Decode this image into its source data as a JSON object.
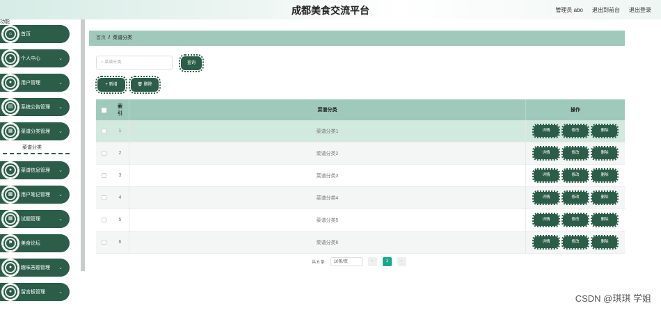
{
  "header": {
    "title": "成都美食交流平台",
    "admin_label": "管理员 abo",
    "to_front": "退出到前台",
    "logout": "退出登录"
  },
  "sidebar": {
    "top_label": "功能",
    "items": [
      {
        "label": "首页",
        "icon": "home-icon"
      },
      {
        "label": "个人中心",
        "icon": "user-icon"
      },
      {
        "label": "用户管理",
        "icon": "user-icon"
      },
      {
        "label": "系统公告管理",
        "icon": "notice-icon"
      },
      {
        "label": "菜谱分类管理",
        "icon": "category-icon"
      },
      {
        "label": "菜谱信息管理",
        "icon": "recipe-icon"
      },
      {
        "label": "用户笔记管理",
        "icon": "note-icon"
      },
      {
        "label": "试题管理",
        "icon": "grid-icon"
      },
      {
        "label": "美食论坛",
        "icon": "flag-icon"
      },
      {
        "label": "趣味答题管理",
        "icon": "quiz-icon"
      },
      {
        "label": "留言板管理",
        "icon": "message-icon"
      }
    ],
    "submenu_label": "菜谱分类"
  },
  "breadcrumb": {
    "home": "首页",
    "separator": "/",
    "current": "菜谱分类"
  },
  "search": {
    "placeholder": "菜谱分类",
    "button": "查询"
  },
  "actions": {
    "add": "+ 新增",
    "delete": "删除"
  },
  "table": {
    "headers": {
      "index": "索引",
      "name": "菜谱分类",
      "ops": "操作"
    },
    "rows": [
      {
        "index": "1",
        "name": "菜谱分类1"
      },
      {
        "index": "2",
        "name": "菜谱分类2"
      },
      {
        "index": "3",
        "name": "菜谱分类3"
      },
      {
        "index": "4",
        "name": "菜谱分类4"
      },
      {
        "index": "5",
        "name": "菜谱分类5"
      },
      {
        "index": "6",
        "name": "菜谱分类6"
      }
    ],
    "op_labels": {
      "detail": "详情",
      "edit": "修改",
      "delete": "删除"
    }
  },
  "pagination": {
    "total": "共 6 条",
    "page_size": "10条/页",
    "prev": "‹",
    "page": "1",
    "next": "›"
  },
  "watermark": "CSDN @琪琪 学姐",
  "colors": {
    "accent": "#2b5d49",
    "header_row": "#9fcabb",
    "active_page": "#17a98a"
  }
}
